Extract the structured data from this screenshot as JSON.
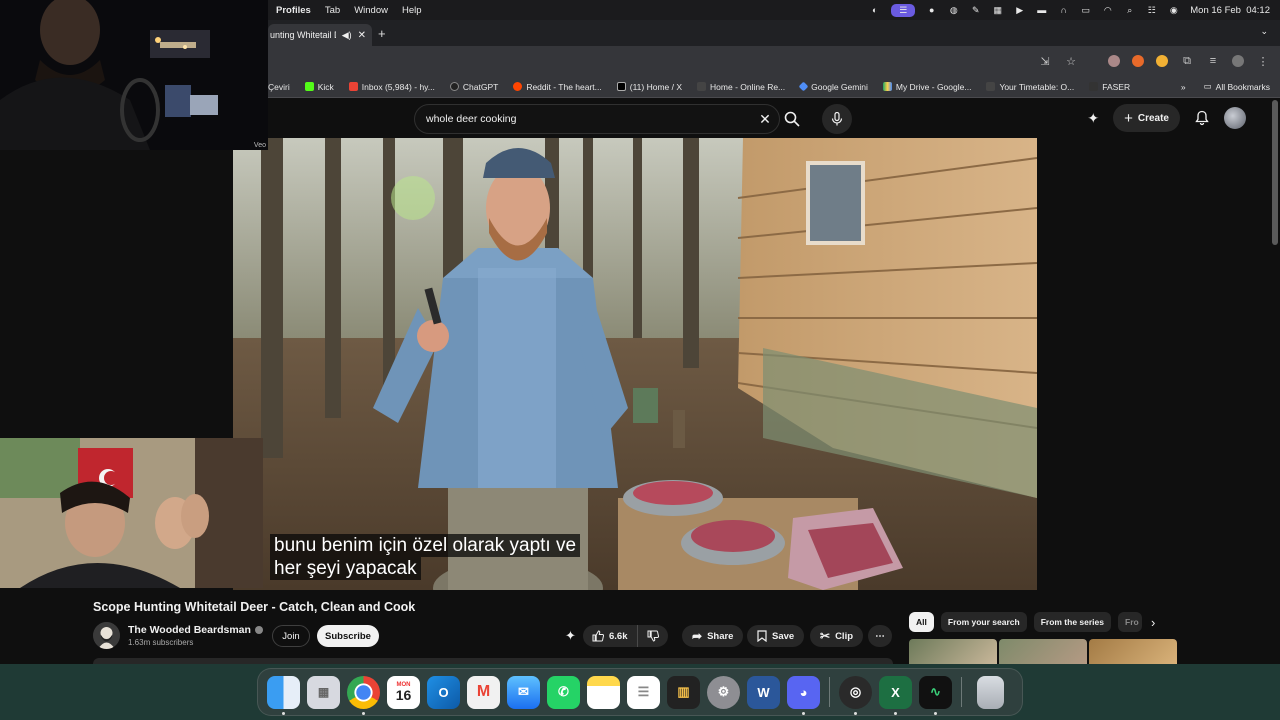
{
  "menubar": {
    "menus": [
      "Profiles",
      "Tab",
      "Window",
      "Help"
    ],
    "datetime": "Mon 16 Feb  04:12"
  },
  "browser": {
    "tab_title": "unting Whitetail D",
    "bookmarks": [
      {
        "label": "Çeviri",
        "color": "#4285f4"
      },
      {
        "label": "Kick",
        "color": "#53fc18"
      },
      {
        "label": "Inbox (5,984) - hy...",
        "color": "#ea4335"
      },
      {
        "label": "ChatGPT",
        "color": "#222222"
      },
      {
        "label": "Reddit - The heart...",
        "color": "#ff4500"
      },
      {
        "label": "(11) Home / X",
        "color": "#000000"
      },
      {
        "label": "Home - Online Re...",
        "color": "#444444"
      },
      {
        "label": "Google Gemini",
        "color": "#4f8ef7"
      },
      {
        "label": "My Drive - Google...",
        "color": "#1fa463"
      },
      {
        "label": "Your Timetable: O...",
        "color": "#444444"
      },
      {
        "label": "FASER",
        "color": "#333333"
      }
    ],
    "all_bookmarks": "All Bookmarks"
  },
  "youtube": {
    "search_value": "whole deer cooking",
    "create_label": "Create",
    "video_title": "Scope Hunting Whitetail Deer - Catch, Clean and Cook",
    "subtitle_line1": "bunu benim için özel olarak yaptı ve",
    "subtitle_line2": "her şeyi yapacak",
    "channel_name": "The Wooded Beardsman",
    "channel_subs": "1.63m subscribers",
    "join_label": "Join",
    "subscribe_label": "Subscribe",
    "like_count": "6.6k",
    "share_label": "Share",
    "save_label": "Save",
    "clip_label": "Clip",
    "chips": [
      "All",
      "From your search",
      "From the series",
      "Fro"
    ]
  },
  "webcam": {
    "tag": "Veo"
  },
  "dock": {
    "calendar_month": "MON",
    "calendar_day": "16"
  }
}
